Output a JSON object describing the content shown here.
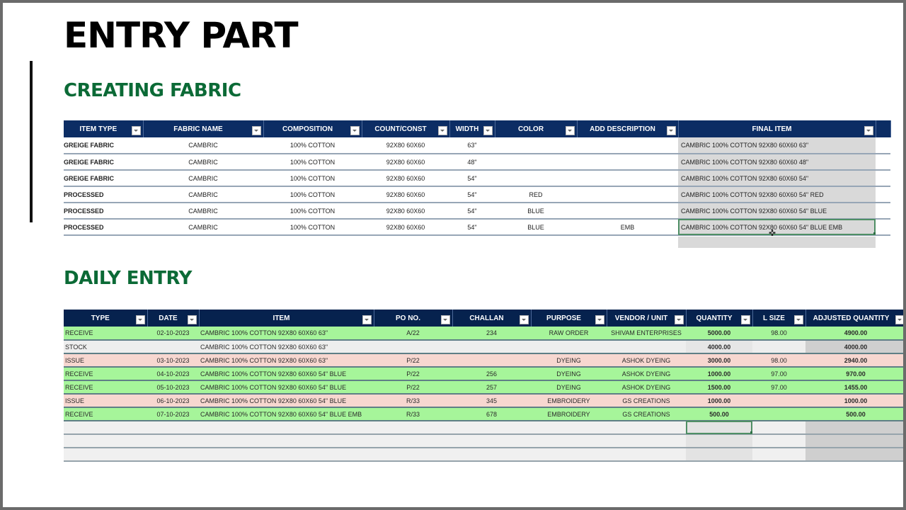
{
  "page": {
    "title": "ENTRY PART"
  },
  "creating_fabric": {
    "title": "CREATING FABRIC",
    "columns": [
      "ITEM TYPE",
      "FABRIC NAME",
      "COMPOSITION",
      "COUNT/CONST",
      "WIDTH",
      "COLOR",
      "ADD DESCRIPTION",
      "FINAL ITEM"
    ],
    "rows": [
      {
        "item_type": "GREIGE FABRIC",
        "fabric_name": "CAMBRIC",
        "composition": "100% COTTON",
        "count_const": "92X80 60X60",
        "width": "63\"",
        "color": "",
        "add_description": "",
        "final_item": "CAMBRIC 100% COTTON 92X80 60X60 63\""
      },
      {
        "item_type": "GREIGE FABRIC",
        "fabric_name": "CAMBRIC",
        "composition": "100% COTTON",
        "count_const": "92X80 60X60",
        "width": "48\"",
        "color": "",
        "add_description": "",
        "final_item": "CAMBRIC 100% COTTON 92X80 60X60 48\""
      },
      {
        "item_type": "GREIGE FABRIC",
        "fabric_name": "CAMBRIC",
        "composition": "100% COTTON",
        "count_const": "92X80 60X60",
        "width": "54\"",
        "color": "",
        "add_description": "",
        "final_item": "CAMBRIC 100% COTTON 92X80 60X60 54\""
      },
      {
        "item_type": "PROCESSED",
        "fabric_name": "CAMBRIC",
        "composition": "100% COTTON",
        "count_const": "92X80 60X60",
        "width": "54\"",
        "color": "RED",
        "add_description": "",
        "final_item": "CAMBRIC 100% COTTON 92X80 60X60 54\" RED"
      },
      {
        "item_type": "PROCESSED",
        "fabric_name": "CAMBRIC",
        "composition": "100% COTTON",
        "count_const": "92X80 60X60",
        "width": "54\"",
        "color": "BLUE",
        "add_description": "",
        "final_item": "CAMBRIC 100% COTTON 92X80 60X60 54\" BLUE"
      },
      {
        "item_type": "PROCESSED",
        "fabric_name": "CAMBRIC",
        "composition": "100% COTTON",
        "count_const": "92X80 60X60",
        "width": "54\"",
        "color": "BLUE",
        "add_description": "EMB",
        "final_item": "CAMBRIC 100% COTTON 92X80 60X60 54\" BLUE EMB"
      }
    ]
  },
  "daily_entry": {
    "title": "DAILY ENTRY",
    "columns": [
      "TYPE",
      "DATE",
      "ITEM",
      "PO NO.",
      "CHALLAN",
      "PURPOSE",
      "VENDOR / UNIT",
      "QUANTITY",
      "L SIZE",
      "ADJUSTED QUANTITY"
    ],
    "rows": [
      {
        "type": "RECEIVE",
        "date": "02-10-2023",
        "item": "CAMBRIC 100% COTTON 92X80 60X60 63\"",
        "po_no": "A/22",
        "challan": "234",
        "purpose": "RAW ORDER",
        "vendor": "SHIVAM ENTERPRISES",
        "quantity": "5000.00",
        "l_size": "98.00",
        "adjusted_quantity": "4900.00"
      },
      {
        "type": "STOCK",
        "date": "",
        "item": "CAMBRIC 100% COTTON 92X80 60X60 63\"",
        "po_no": "",
        "challan": "",
        "purpose": "",
        "vendor": "",
        "quantity": "4000.00",
        "l_size": "",
        "adjusted_quantity": "4000.00"
      },
      {
        "type": "ISSUE",
        "date": "03-10-2023",
        "item": "CAMBRIC 100% COTTON 92X80 60X60 63\"",
        "po_no": "P/22",
        "challan": "",
        "purpose": "DYEING",
        "vendor": "ASHOK DYEING",
        "quantity": "3000.00",
        "l_size": "98.00",
        "adjusted_quantity": "2940.00"
      },
      {
        "type": "RECEIVE",
        "date": "04-10-2023",
        "item": "CAMBRIC 100% COTTON 92X80 60X60 54\" BLUE",
        "po_no": "P/22",
        "challan": "256",
        "purpose": "DYEING",
        "vendor": "ASHOK DYEING",
        "quantity": "1000.00",
        "l_size": "97.00",
        "adjusted_quantity": "970.00"
      },
      {
        "type": "RECEIVE",
        "date": "05-10-2023",
        "item": "CAMBRIC 100% COTTON 92X80 60X60 54\" BLUE",
        "po_no": "P/22",
        "challan": "257",
        "purpose": "DYEING",
        "vendor": "ASHOK DYEING",
        "quantity": "1500.00",
        "l_size": "97.00",
        "adjusted_quantity": "1455.00"
      },
      {
        "type": "ISSUE",
        "date": "06-10-2023",
        "item": "CAMBRIC 100% COTTON 92X80 60X60 54\" BLUE",
        "po_no": "R/33",
        "challan": "345",
        "purpose": "EMBROIDERY",
        "vendor": "GS CREATIONS",
        "quantity": "1000.00",
        "l_size": "",
        "adjusted_quantity": "1000.00"
      },
      {
        "type": "RECEIVE",
        "date": "07-10-2023",
        "item": "CAMBRIC 100% COTTON 92X80 60X60 54\" BLUE EMB",
        "po_no": "R/33",
        "challan": "678",
        "purpose": "EMBROIDERY",
        "vendor": "GS CREATIONS",
        "quantity": "500.00",
        "l_size": "",
        "adjusted_quantity": "500.00"
      }
    ],
    "empty_rows": 3
  },
  "colors": {
    "header_blue": "#0c2d64",
    "section_green": "#0b6a36",
    "receive_row": "#a6f59a",
    "issue_row": "#f7d7d0",
    "stock_row": "#eeeeee",
    "final_item_fill": "#d9d9d9"
  },
  "icons": {
    "filter_dropdown": "filter-dropdown-icon",
    "cursor": "cell-select-cursor-icon"
  }
}
